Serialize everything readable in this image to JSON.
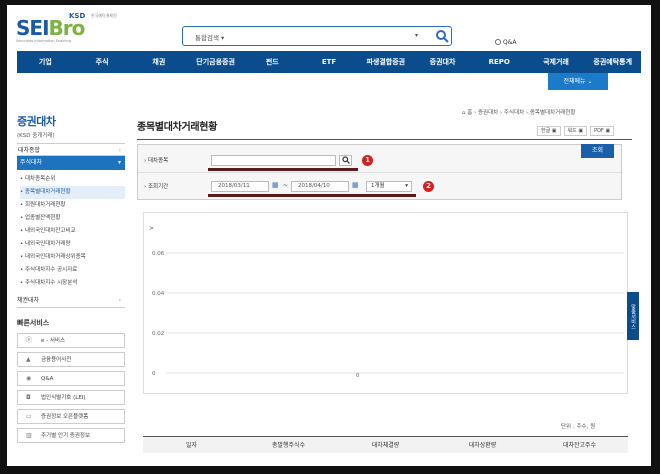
{
  "header": {
    "logo_main": "SEI",
    "logo_bro": "Bro",
    "logo_ksd": "KSD",
    "logo_ksd_sub": "한국예탁결제원",
    "logo_sub": "Securities Information Enabling",
    "search_select": "통합검색",
    "qna": "Q&A"
  },
  "nav": [
    "기업",
    "주식",
    "채권",
    "단기금융증권",
    "펀드",
    "ETF",
    "파생결합증권",
    "증권대차",
    "REPO",
    "국제거래",
    "증권예탁통계"
  ],
  "all_menu": "전체메뉴",
  "sidebar": {
    "title": "증권대차",
    "subtitle": "(KSD 중개거래)",
    "section1": "대차종합",
    "active": "주식대차",
    "items": [
      "대차종목순위",
      "종목별대차거래현황",
      "회원대차거래현황",
      "업종별잔액현황",
      "내외국인대차잔고비교",
      "내외국인대차거래량",
      "내외국인대차거래상위종목",
      "주식대차지수 공시자료",
      "주식대차지수 시장분석"
    ],
    "bond": "채권대차",
    "quick_title": "빠른서비스",
    "quick": [
      {
        "icon": "e-icon",
        "label": "e - 서비스"
      },
      {
        "icon": "cap-icon",
        "label": "금융용어사전"
      },
      {
        "icon": "chat-icon",
        "label": "Q&A"
      },
      {
        "icon": "lei-icon",
        "label": "법인식별기호 (LEI)"
      },
      {
        "icon": "captech-icon",
        "label": "증권정보 오픈플랫폼"
      },
      {
        "icon": "chart-icon",
        "label": "주기별 인기 증권정보"
      }
    ]
  },
  "main": {
    "breadcrumb": "⌂  홈  › 증권대차 › 주식대차 › 종목별대차거래현황",
    "title": "종목별대차거래현황",
    "util_buttons": [
      "한글",
      "워드",
      "PDF"
    ],
    "label_stock": "대차종목",
    "label_period": "조회기간",
    "date_from": "2018/03/11",
    "date_to": "2018/04/10",
    "period_select": "1개월",
    "search_btn": "조회",
    "badge1": "1",
    "badge2": "2",
    "unit": "단위 : 주수, 원",
    "columns": [
      "일자",
      "총발행주식수",
      "대차체결량",
      "대차상환량",
      "대차잔고주수"
    ],
    "side_tab": "맞춤서비스"
  },
  "chart_data": {
    "type": "line",
    "x": [],
    "series": [],
    "yticks": [
      "0.06",
      "0.04",
      "0.02",
      "0"
    ],
    "point_label": "0",
    "top_marker": ">"
  }
}
